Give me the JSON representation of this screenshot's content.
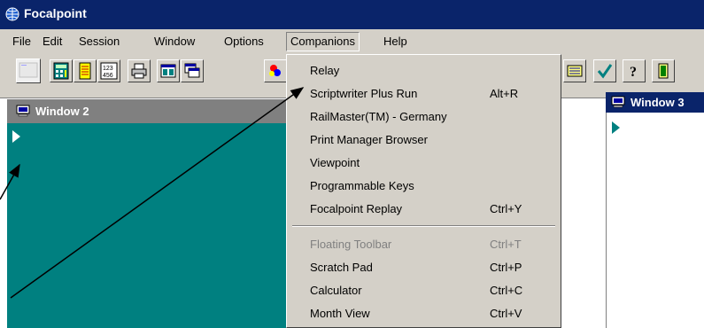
{
  "app": {
    "title": "Focalpoint"
  },
  "menubar": {
    "items": [
      {
        "label": "File"
      },
      {
        "label": "Edit"
      },
      {
        "label": "Session"
      },
      {
        "label": "Window"
      },
      {
        "label": "Options"
      },
      {
        "label": "Companions"
      },
      {
        "label": "Help"
      }
    ]
  },
  "companions_menu": {
    "items": [
      {
        "label": "Relay",
        "shortcut": "",
        "enabled": true
      },
      {
        "label": "Scriptwriter Plus Run",
        "shortcut": "Alt+R",
        "enabled": true
      },
      {
        "label": "RailMaster(TM) - Germany",
        "shortcut": "",
        "enabled": true
      },
      {
        "label": "Print Manager Browser",
        "shortcut": "",
        "enabled": true
      },
      {
        "label": "Viewpoint",
        "shortcut": "",
        "enabled": true
      },
      {
        "label": "Programmable Keys",
        "shortcut": "",
        "enabled": true
      },
      {
        "label": "Focalpoint Replay",
        "shortcut": "Ctrl+Y",
        "enabled": true
      },
      {
        "label": "Floating Toolbar",
        "shortcut": "Ctrl+T",
        "enabled": false
      },
      {
        "label": "Scratch Pad",
        "shortcut": "Ctrl+P",
        "enabled": true
      },
      {
        "label": "Calculator",
        "shortcut": "Ctrl+C",
        "enabled": true
      },
      {
        "label": "Month View",
        "shortcut": "Ctrl+V",
        "enabled": true
      }
    ]
  },
  "windows": {
    "window2": {
      "title": "Window 2",
      "background": "#008080"
    },
    "window3": {
      "title": "Window 3",
      "background": "#ffffff"
    }
  },
  "toolbar": {
    "buttons": [
      "blank-terminal-icon",
      "calculator-icon",
      "notepad-icon",
      "calendar-icon",
      "printer-icon",
      "tile-windows-icon",
      "cascade-windows-icon",
      "color-icon",
      "filing-icon",
      "check-icon",
      "help-icon",
      "exit-icon"
    ]
  },
  "colors": {
    "titlebar": "#0a246a",
    "chrome": "#d4d0c8",
    "teal": "#008080",
    "inactive_title": "#808080"
  }
}
